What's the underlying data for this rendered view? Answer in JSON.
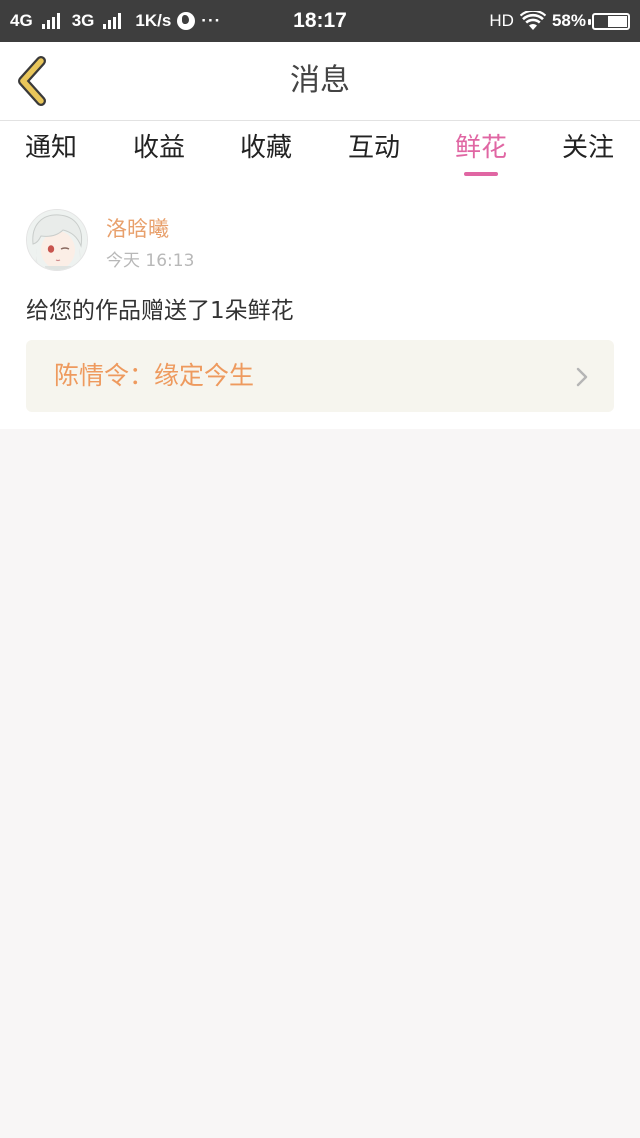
{
  "status_bar": {
    "sim1": "4G",
    "sim2": "3G",
    "speed": "1K/s",
    "dots": "···",
    "time": "18:17",
    "hd": "HD",
    "battery": "58%",
    "battery_level": 0.58
  },
  "header": {
    "title": "消息"
  },
  "tabs": [
    {
      "label": "通知",
      "active": false
    },
    {
      "label": "收益",
      "active": false
    },
    {
      "label": "收藏",
      "active": false
    },
    {
      "label": "互动",
      "active": false
    },
    {
      "label": "鲜花",
      "active": true
    },
    {
      "label": "关注",
      "active": false
    }
  ],
  "message": {
    "username": "洛晗曦",
    "time": "今天 16:13",
    "text": "给您的作品赠送了1朵鲜花",
    "work_title": "陈情令：缘定今生"
  },
  "colors": {
    "accent": "#e066a3",
    "username": "#e8a06c",
    "work_title": "#ee9a5e",
    "back_arrow": "#e9c65a"
  }
}
